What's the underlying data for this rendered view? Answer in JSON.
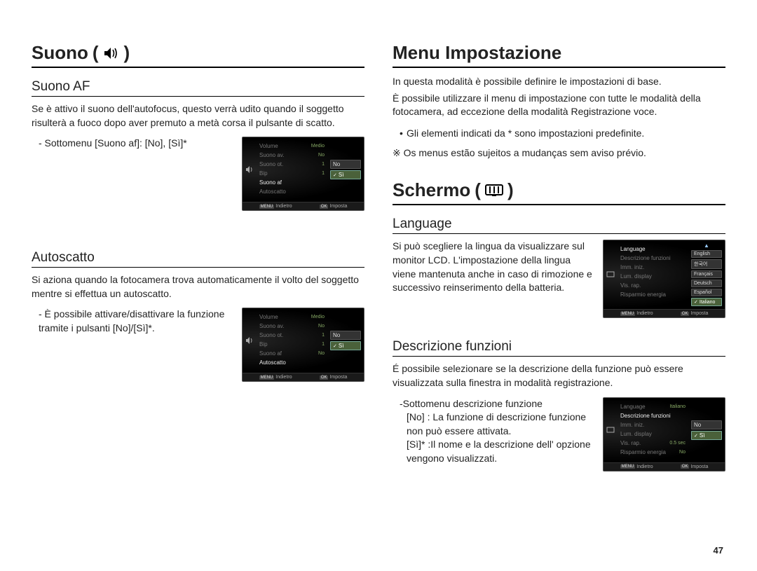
{
  "left": {
    "title": "Suono",
    "sec1": {
      "heading": "Suono AF",
      "body": "Se è attivo il suono dell'autofocus, questo verrà udito quando il soggetto risulterà a fuoco dopo aver premuto a metà corsa il pulsante di scatto.",
      "sub": "- Sottomenu [Suono af]: [No], [Sì]*"
    },
    "sec2": {
      "heading": "Autoscatto",
      "body": "Si aziona quando la fotocamera trova automaticamente il volto del soggetto mentre si effettua un autoscatto.",
      "sub": "- È possibile attivare/disattivare la funzione tramite i pulsanti [No]/[Sì]*."
    }
  },
  "right": {
    "title1": "Menu Impostazione",
    "p1": "In questa modalità è possibile definire le impostazioni di base.",
    "p2": "È possibile utilizzare il menu di impostazione con tutte le modalità della fotocamera, ad eccezione della modalità Registrazione voce.",
    "b1": "Gli elementi indicati da * sono impostazioni predefinite.",
    "note": "※ Os menus estão sujeitos a mudanças sem aviso prévio.",
    "title2": "Schermo",
    "lang": {
      "heading": "Language",
      "body": "Si può scegliere la lingua da visualizzare sul monitor LCD. L'impostazione della lingua viene mantenuta anche in caso di rimozione e successivo reinserimento della batteria."
    },
    "desc": {
      "heading": "Descrizione funzioni",
      "body": "É possibile selezionare se la descrizione della funzione può essere visualizzata sulla finestra in modalità registrazione.",
      "subhead": "-Sottomenu descrizione funzione",
      "no_label": "[No]",
      "no_text": ": La funzione di descrizione funzione non può essere attivata.",
      "si_label": "[Sì]*",
      "si_text": ":Il nome e la descrizione dell' opzione vengono visualizzati."
    }
  },
  "ss_sound": {
    "items": [
      "Volume",
      "Suono av.",
      "Suono ot.",
      "Bip",
      "Suono af",
      "Autoscatto"
    ],
    "vals": [
      "Medio",
      "No",
      "1",
      "1",
      "",
      ""
    ],
    "opts": [
      "No",
      "Sì"
    ],
    "footer_back": "Indietro",
    "footer_set": "Imposta"
  },
  "ss_sound2_sel": "Autoscatto",
  "ss_lang": {
    "items": [
      "Language",
      "Descrizione funzioni",
      "Imm. iniz.",
      "Lum. display",
      "Vis. rap.",
      "Risparmio energia"
    ],
    "opts": [
      "English",
      "한국어",
      "Français",
      "Deutsch",
      "Español",
      "Italiano"
    ]
  },
  "ss_desc": {
    "items": [
      "Language",
      "Descrizione funzioni",
      "Imm. iniz.",
      "Lum. display",
      "Vis. rap.",
      "Risparmio energia"
    ],
    "vals": [
      "Italiano",
      "",
      "",
      "",
      "0.5 sec",
      "No"
    ],
    "opts": [
      "No",
      "Sì"
    ]
  },
  "page_number": "47"
}
